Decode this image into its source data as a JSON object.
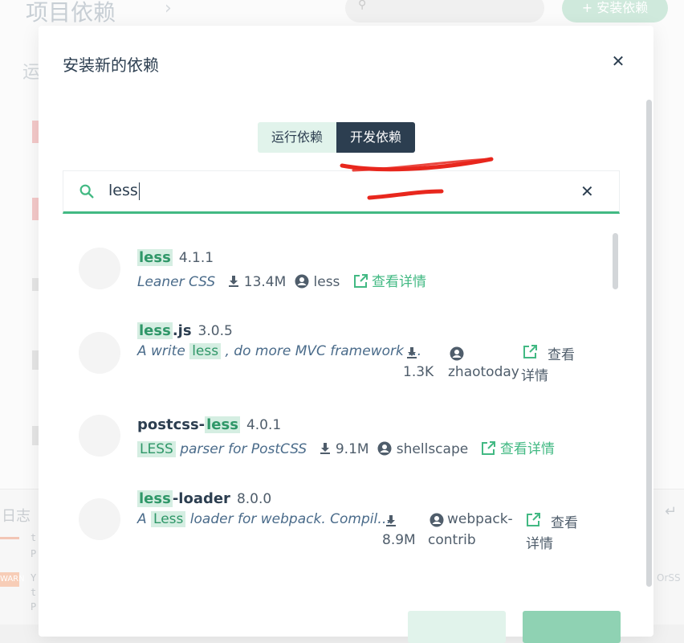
{
  "background": {
    "title": "项目依赖",
    "section_label": "运",
    "install_button": "+ 安装依赖",
    "log_label": "日志",
    "warn_tag": "WARN",
    "right_text": "OrSS",
    "log_lines": [
      "t",
      "P",
      "Y",
      "t",
      "P"
    ]
  },
  "modal": {
    "title": "安装新的依赖",
    "toggle": {
      "runtime_label": "运行依赖",
      "dev_label": "开发依赖",
      "active": "dev"
    },
    "search": {
      "value": "less"
    },
    "packages": [
      {
        "name_highlight": "less",
        "name_rest": "",
        "version": "4.1.1",
        "desc": "Leaner CSS",
        "downloads": "13.4M",
        "author": "less",
        "details": "查看详情"
      },
      {
        "name_highlight": "less",
        "name_rest": ".js",
        "version": "3.0.5",
        "desc_pre": "A write ",
        "desc_hl": "less",
        "desc_post": " , do more MVC framework …",
        "downloads": "1.3K",
        "author": "zhaotoday",
        "details_1": "查看",
        "details_2": "详情"
      },
      {
        "name_pre": "postcss-",
        "name_highlight": "less",
        "version": "4.0.1",
        "desc_hl": "LESS",
        "desc_post": " parser for PostCSS",
        "downloads": "9.1M",
        "author": "shellscape",
        "details": "查看详情"
      },
      {
        "name_highlight": "less",
        "name_rest": "-loader",
        "version": "8.0.0",
        "desc_pre": "A ",
        "desc_hl": "Less",
        "desc_post": " loader for webpack. Compil…",
        "downloads": "8.9M",
        "author_1": "webpack-",
        "author_2": "contrib",
        "details_1": "查看",
        "details_2": "详情"
      }
    ]
  },
  "colors": {
    "accent": "#42b983",
    "dark": "#2c3e50",
    "highlight_bg": "#d5eee2",
    "annotation": "#e8271d"
  }
}
